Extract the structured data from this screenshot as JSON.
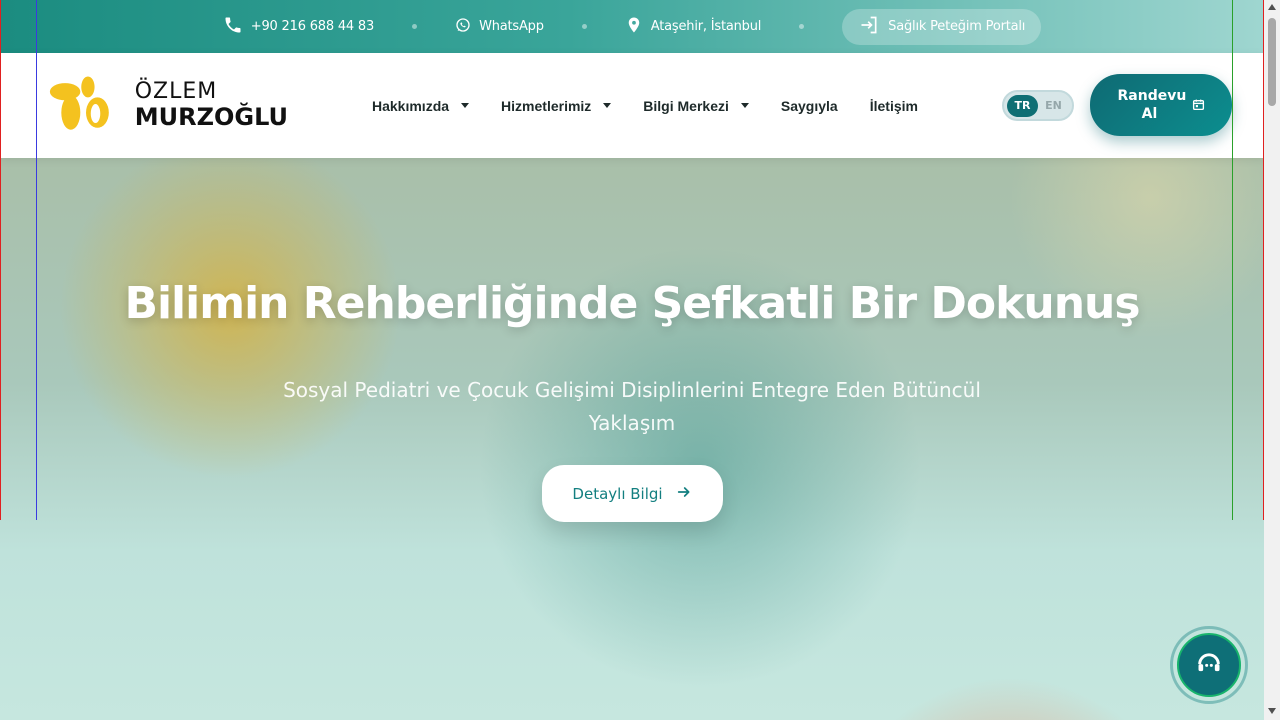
{
  "topbar": {
    "phone": "+90 216 688 44 83",
    "whatsapp": "WhatsApp",
    "location": "Ataşehir, İstanbul",
    "portal": "Sağlık Peteğim Portalı"
  },
  "logo": {
    "line1": "ÖZLEM",
    "line2": "MURZOĞLU"
  },
  "nav": [
    {
      "label": "Hakkımızda",
      "dropdown": true
    },
    {
      "label": "Hizmetlerimiz",
      "dropdown": true
    },
    {
      "label": "Bilgi Merkezi",
      "dropdown": true
    },
    {
      "label": "Saygıyla",
      "dropdown": false
    },
    {
      "label": "İletişim",
      "dropdown": false
    }
  ],
  "lang": {
    "active": "TR",
    "inactive": "EN"
  },
  "cta": {
    "label": "Randevu Al"
  },
  "hero": {
    "title": "Bilimin Rehberliğinde Şefkatli Bir Dokunuş",
    "subtitle": "Sosyal Pediatri ve Çocuk Gelişimi Disiplinlerini Entegre Eden Bütüncül Yaklaşım",
    "button": "Detaylı Bilgi"
  },
  "colors": {
    "brand_teal": "#0f6f74",
    "accent_yellow": "#f4c21f",
    "accent_coral": "#e8906e"
  },
  "icons": {
    "phone": "phone-icon",
    "whatsapp": "whatsapp-icon",
    "location": "location-pin-icon",
    "portal": "login-icon",
    "calendar": "calendar-icon",
    "arrow": "arrow-right-icon",
    "support": "support-headset-icon"
  }
}
